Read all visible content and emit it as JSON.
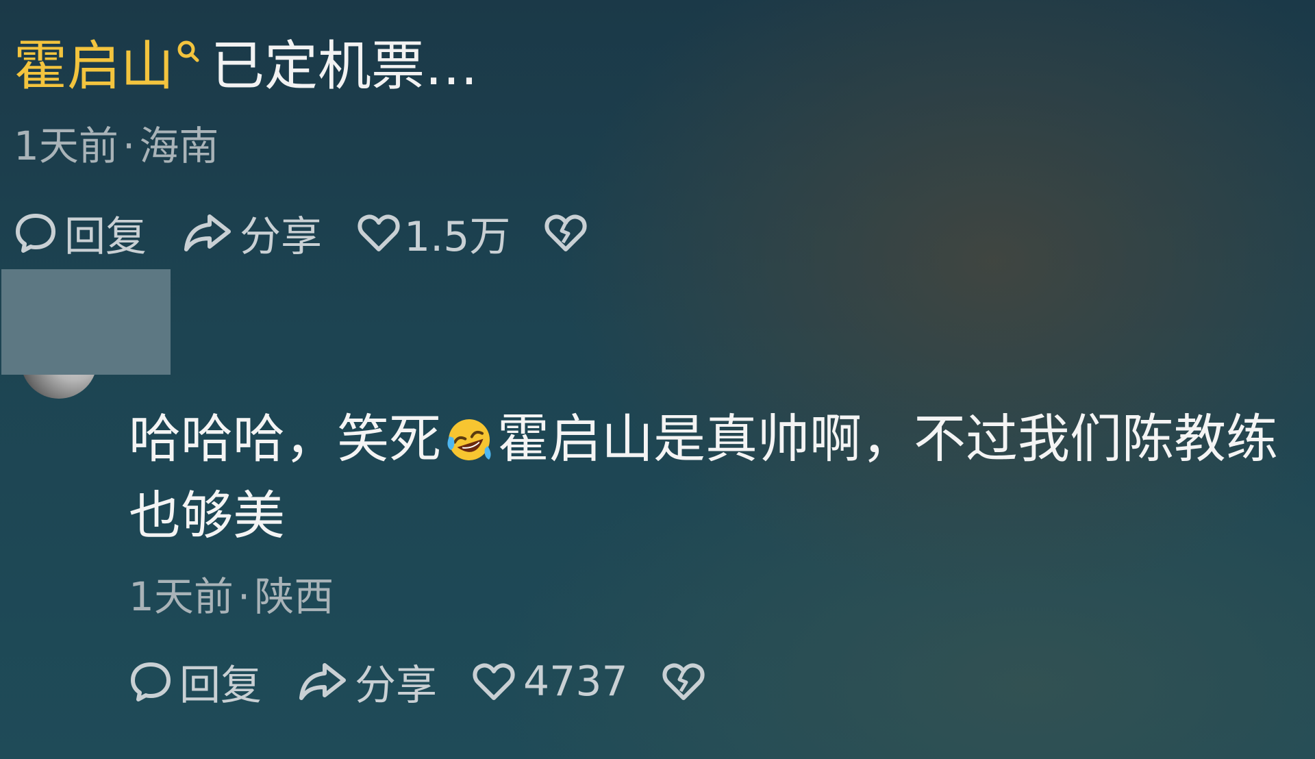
{
  "comment": {
    "mention": "霍启山",
    "text": "已定机票…",
    "time": "1天前",
    "separator": "·",
    "location": "海南",
    "actions": {
      "reply": "回复",
      "share": "分享",
      "likes": "1.5万"
    }
  },
  "reply": {
    "text_before_emoji": "哈哈哈，笑死",
    "emoji": "rolling-on-floor-laughing",
    "text_after_emoji": "霍启山是真帅啊，不过我们陈教练也够美",
    "time": "1天前",
    "separator": "·",
    "location": "陕西",
    "actions": {
      "reply": "回复",
      "share": "分享",
      "likes": "4737"
    }
  },
  "icons": {
    "reply": "speech-bubble-icon",
    "share": "share-arrow-icon",
    "like": "heart-icon",
    "dislike": "broken-heart-icon",
    "mention": "search-icon"
  },
  "colors": {
    "mention": "#f3c43e",
    "meta": "#a9b3b8",
    "action": "#c9d0d4"
  }
}
